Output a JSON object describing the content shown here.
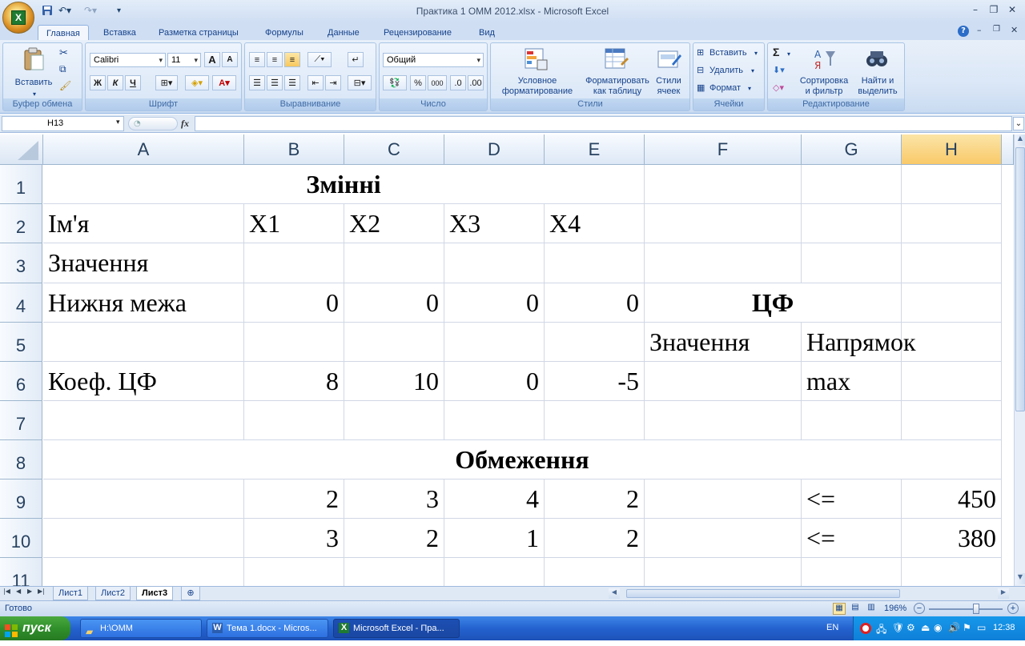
{
  "window": {
    "title": "Практика 1 ОММ 2012.xlsx - Microsoft Excel",
    "logo_letter": "X"
  },
  "ribbon": {
    "tabs": [
      "Главная",
      "Вставка",
      "Разметка страницы",
      "Формулы",
      "Данные",
      "Рецензирование",
      "Вид"
    ],
    "active_tab": "Главная",
    "clipboard": {
      "paste": "Вставить",
      "label": "Буфер обмена"
    },
    "font": {
      "name": "Calibri",
      "size": "11",
      "bold": "Ж",
      "italic": "К",
      "underline": "Ч",
      "grow": "A",
      "shrink": "A",
      "label": "Шрифт"
    },
    "alignment": {
      "label": "Выравнивание"
    },
    "number": {
      "format": "Общий",
      "percent": "%",
      "thousands": "000",
      "label": "Число"
    },
    "styles": {
      "conditional": "Условное\nформатирование",
      "format_table": "Форматировать\nкак таблицу",
      "cell_styles": "Стили\nячеек",
      "label": "Стили"
    },
    "cells": {
      "insert": "Вставить",
      "delete": "Удалить",
      "format": "Формат",
      "label": "Ячейки"
    },
    "editing": {
      "sum": "Σ",
      "sort": "Сортировка\nи фильтр",
      "find": "Найти и\nвыделить",
      "label": "Редактирование"
    }
  },
  "formula_bar": {
    "name_box": "H13",
    "fx": "fx",
    "value": ""
  },
  "columns": [
    "A",
    "B",
    "C",
    "D",
    "E",
    "F",
    "G",
    "H"
  ],
  "selected_column": "H",
  "rows": [
    "1",
    "2",
    "3",
    "4",
    "5",
    "6",
    "7",
    "8",
    "9",
    "10",
    "11"
  ],
  "cells": {
    "title_vars": "Змінні",
    "r2": {
      "a": "Ім'я",
      "b": "X1",
      "c": "X2",
      "d": "X3",
      "e": "X4"
    },
    "r3": {
      "a": "Значення"
    },
    "r4": {
      "a": "Нижня межа",
      "b": "0",
      "c": "0",
      "d": "0",
      "e": "0",
      "f": "ЦФ"
    },
    "r5": {
      "f": "Значення",
      "g": "Напрямок"
    },
    "r6": {
      "a": "Коеф. ЦФ",
      "b": "8",
      "c": "10",
      "d": "0",
      "e": "-5",
      "g": "max"
    },
    "title_constraints": "Обмеження",
    "r9": {
      "b": "2",
      "c": "3",
      "d": "4",
      "e": "2",
      "g": "<=",
      "h": "450"
    },
    "r10": {
      "b": "3",
      "c": "2",
      "d": "1",
      "e": "2",
      "g": "<=",
      "h": "380"
    }
  },
  "sheets": [
    "Лист1",
    "Лист2",
    "Лист3"
  ],
  "active_sheet": "Лист3",
  "status": {
    "ready": "Готово",
    "zoom": "196%"
  },
  "taskbar": {
    "start": "пуск",
    "tasks": [
      "H:\\ОММ",
      "Тема 1.docx - Micros...",
      "Microsoft Excel - Пра..."
    ],
    "lang": "EN",
    "clock": "12:38"
  }
}
